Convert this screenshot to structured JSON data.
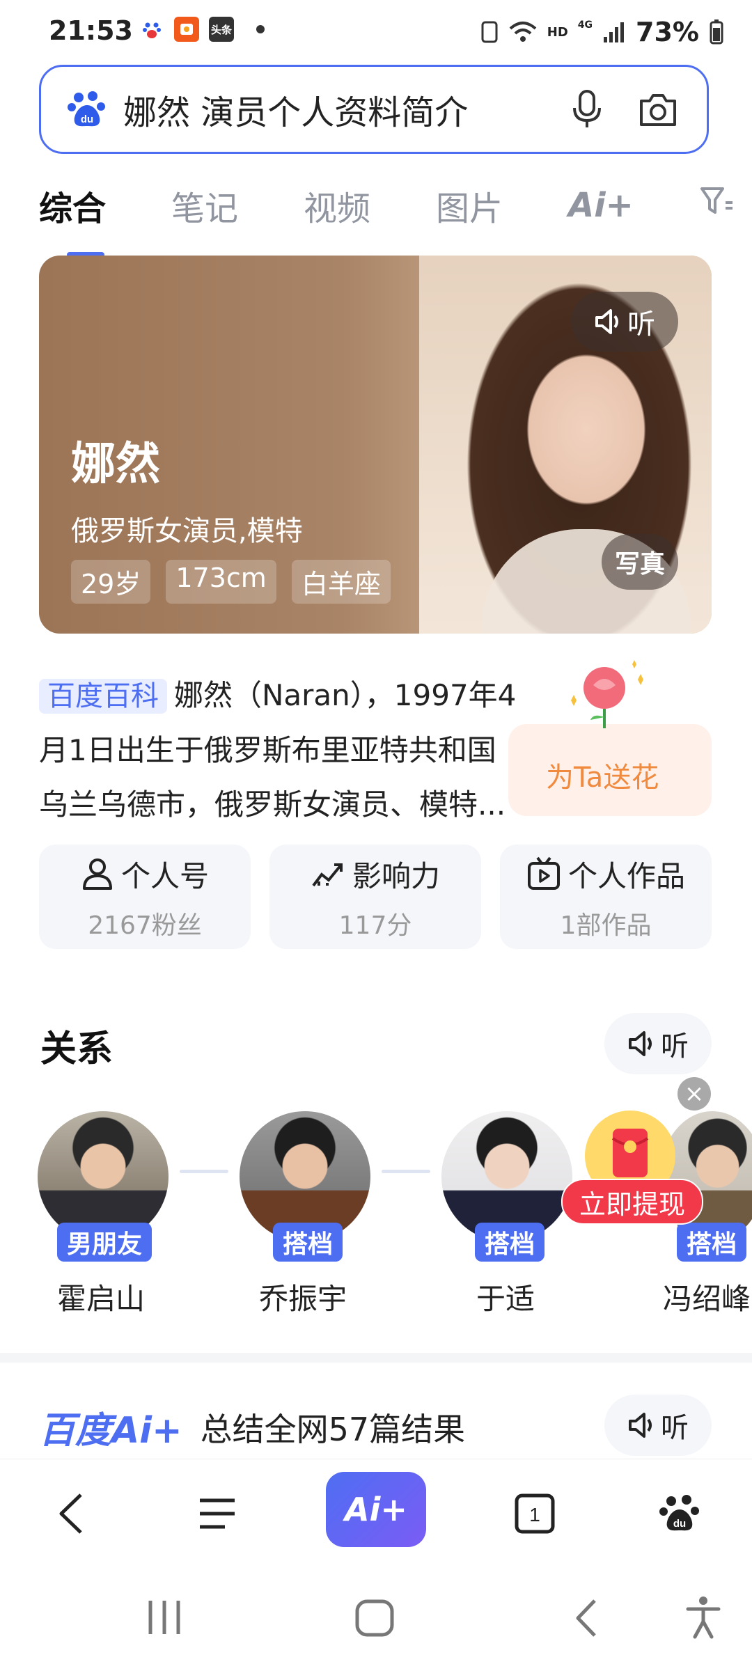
{
  "status_bar": {
    "time": "21:53",
    "battery": "73%",
    "hd_label": "HD",
    "net_label": "4G",
    "toutiao_label": "头条"
  },
  "search": {
    "query": "娜然 演员个人资料简介"
  },
  "tabs": [
    {
      "label": "综合"
    },
    {
      "label": "笔记"
    },
    {
      "label": "视频"
    },
    {
      "label": "图片"
    },
    {
      "label": "Ai+"
    }
  ],
  "hero": {
    "name": "娜然",
    "description": "俄罗斯女演员,模特",
    "tags": [
      "29岁",
      "173cm",
      "白羊座"
    ],
    "listen_label": "听",
    "photos_label": "写真"
  },
  "baike": {
    "source": "百度百科",
    "text_lines": [
      "娜然（Naran），1997年4",
      "月1日出生于俄罗斯布里亚特共和国",
      "乌兰乌德市，俄罗斯女演员、模特..."
    ]
  },
  "flower": {
    "label": "为Ta送花"
  },
  "stats": [
    {
      "title": "个人号",
      "sub": "2167粉丝"
    },
    {
      "title": "影响力",
      "sub": "117分"
    },
    {
      "title": "个人作品",
      "sub": "1部作品"
    }
  ],
  "relations": {
    "title": "关系",
    "listen_label": "听",
    "people": [
      {
        "badge": "男朋友",
        "name": "霍启山"
      },
      {
        "badge": "搭档",
        "name": "乔振宇"
      },
      {
        "badge": "搭档",
        "name": "于适"
      },
      {
        "badge": "搭档",
        "name": "冯绍峰"
      }
    ],
    "promo_label": "立即提现"
  },
  "ai_summary": {
    "logo": "百度Ai+",
    "text": "总结全网57篇结果",
    "listen_label": "听"
  },
  "bottom_nav": {
    "ai_label": "Ai+",
    "tab_count": "1"
  },
  "colors": {
    "accent": "#4e6ef2",
    "promo_red": "#f2394a",
    "flower_orange": "#f08a3e"
  }
}
